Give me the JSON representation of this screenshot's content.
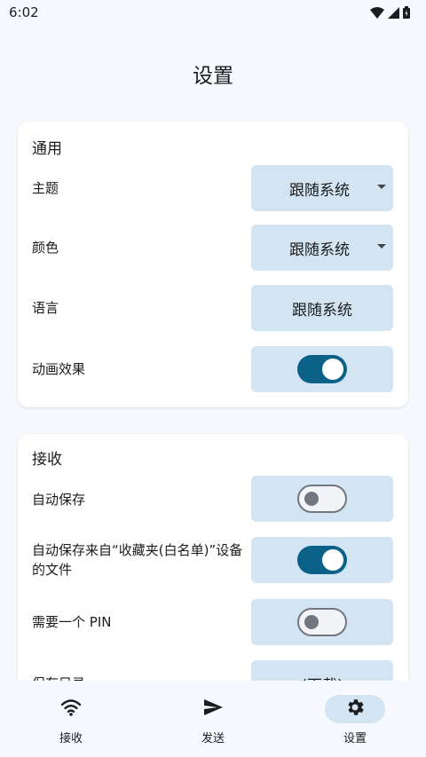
{
  "status_bar": {
    "time": "6:02"
  },
  "page": {
    "title": "设置"
  },
  "general": {
    "title": "通用",
    "theme": {
      "label": "主题",
      "value": "跟随系统"
    },
    "color": {
      "label": "颜色",
      "value": "跟随系统"
    },
    "language": {
      "label": "语言",
      "value": "跟随系统"
    },
    "animation": {
      "label": "动画效果",
      "enabled": true
    }
  },
  "receive": {
    "title": "接收",
    "auto_save": {
      "label": "自动保存",
      "enabled": false
    },
    "auto_save_favorites": {
      "label": "自动保存来自“收藏夹(白名单)”设备的文件",
      "enabled": true
    },
    "require_pin": {
      "label": "需要一个 PIN",
      "enabled": false
    },
    "save_dir": {
      "label": "保存目录",
      "value": "(下载)"
    }
  },
  "bottom_nav": {
    "items": [
      {
        "label": "接收",
        "icon": "wifi-icon",
        "active": false
      },
      {
        "label": "发送",
        "icon": "send-icon",
        "active": false
      },
      {
        "label": "设置",
        "icon": "gear-icon",
        "active": true
      }
    ]
  },
  "colors": {
    "accent": "#0b6187",
    "control_bg": "#d3e4f3",
    "background": "#f7f9fe"
  }
}
